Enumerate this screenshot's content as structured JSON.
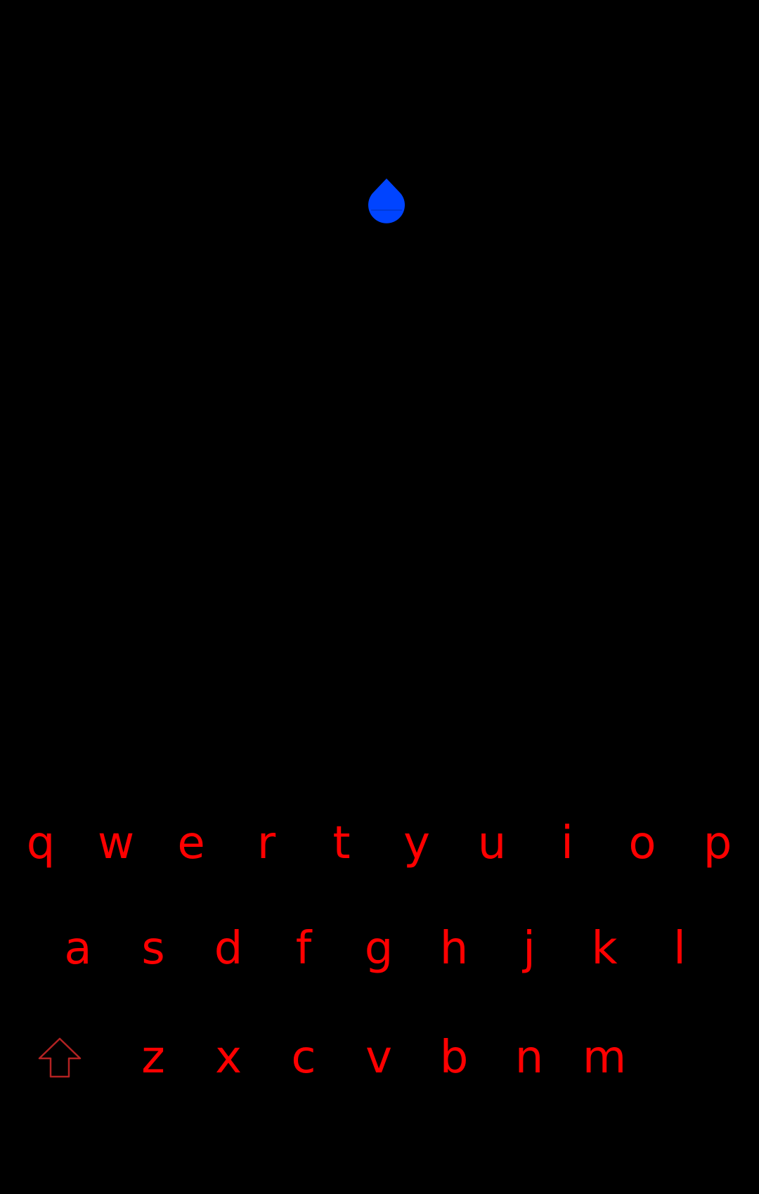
{
  "colors": {
    "background": "#000000",
    "key_text": "#ff0000",
    "cursor_handle": "#0044ff",
    "shift_outline": "#b22222"
  },
  "cursor_handle": {
    "icon": "text-cursor-drop-handle-icon"
  },
  "keyboard": {
    "rows": [
      [
        "q",
        "w",
        "e",
        "r",
        "t",
        "y",
        "u",
        "i",
        "o",
        "p"
      ],
      [
        "a",
        "s",
        "d",
        "f",
        "g",
        "h",
        "j",
        "k",
        "l"
      ],
      [
        "z",
        "x",
        "c",
        "v",
        "b",
        "n",
        "m"
      ]
    ],
    "shift": {
      "icon": "shift-arrow-icon"
    }
  }
}
